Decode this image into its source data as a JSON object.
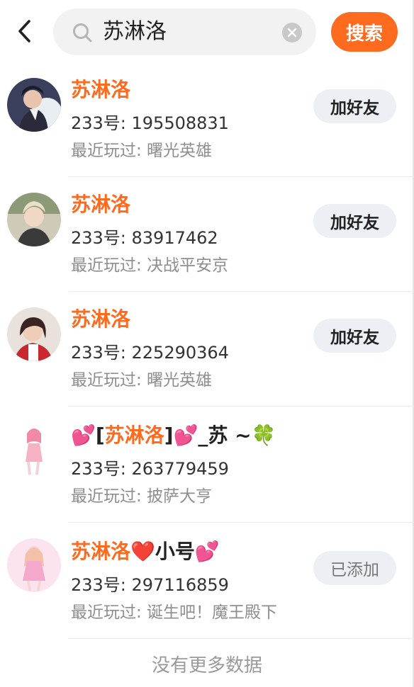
{
  "search": {
    "query": "苏淋洛",
    "button_label": "搜索"
  },
  "results": [
    {
      "name": "苏淋洛",
      "id_line": "233号: 195508831",
      "played_line": "最近玩过: 曙光英雄",
      "action_label": "加好友"
    },
    {
      "name": "苏淋洛",
      "id_line": "233号: 83917462",
      "played_line": "最近玩过: 决战平安京",
      "action_label": "加好友"
    },
    {
      "name": "苏淋洛",
      "id_line": "233号: 225290364",
      "played_line": "最近玩过: 曙光英雄",
      "action_label": "加好友"
    },
    {
      "name_prefix": "💕[",
      "name_highlight": "苏淋洛",
      "name_suffix": "]💕_苏 ~🍀",
      "id_line": "233号: 263779459",
      "played_line": "最近玩过: 披萨大亨"
    },
    {
      "name_highlight": "苏淋洛",
      "name_suffix": "❤️小号💕",
      "id_line": "233号: 297116859",
      "played_line": "最近玩过: 诞生吧！魔王殿下",
      "action_label": "已添加"
    }
  ],
  "footer_text": "没有更多数据",
  "colors": {
    "accent": "#fe6a1e",
    "button_bg": "#eceff4",
    "muted_text": "#8e8e8e"
  },
  "icons": [
    "back-arrow-icon",
    "search-icon",
    "clear-icon"
  ]
}
